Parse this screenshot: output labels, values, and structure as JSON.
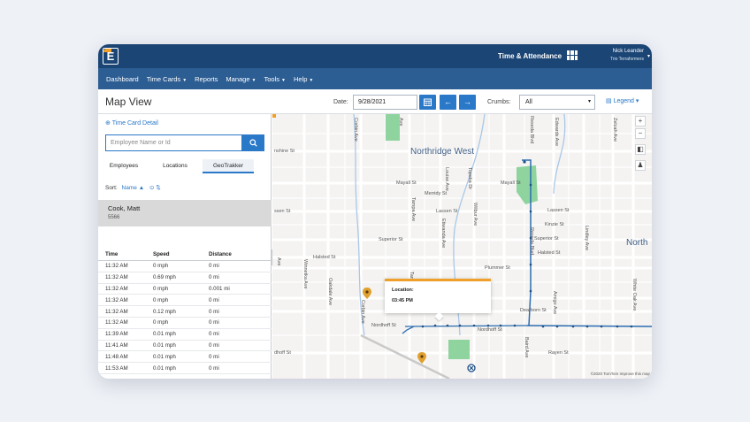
{
  "header": {
    "logo": "E",
    "app_title": "Time & Attendance",
    "user_name": "Nick Leander",
    "user_org": "Trio Terraformers"
  },
  "nav": {
    "items": [
      {
        "label": "Dashboard",
        "has_menu": false
      },
      {
        "label": "Time Cards",
        "has_menu": true
      },
      {
        "label": "Reports",
        "has_menu": false
      },
      {
        "label": "Manage",
        "has_menu": true
      },
      {
        "label": "Tools",
        "has_menu": true
      },
      {
        "label": "Help",
        "has_menu": true
      }
    ]
  },
  "toolbar": {
    "page_title": "Map View",
    "date_label": "Date:",
    "date_value": "9/28/2021",
    "crumbs_label": "Crumbs:",
    "crumbs_value": "All",
    "legend_label": "Legend"
  },
  "left_panel": {
    "time_card_link": "Time Card Detail",
    "search_placeholder": "Employee Name or Id",
    "tabs": [
      "Employees",
      "Locations",
      "GeoTrakker"
    ],
    "active_tab": "GeoTrakker",
    "sort_label": "Sort:",
    "sort_field": "Name",
    "employee": {
      "name": "Cook, Matt",
      "id": "5566"
    },
    "table": {
      "headers": [
        "Time",
        "Speed",
        "Distance"
      ],
      "rows": [
        [
          "11:32 AM",
          "0 mph",
          "0 mi"
        ],
        [
          "11:32 AM",
          "0.69 mph",
          "0 mi"
        ],
        [
          "11:32 AM",
          "0 mph",
          "0.001 mi"
        ],
        [
          "11:32 AM",
          "0 mph",
          "0 mi"
        ],
        [
          "11:32 AM",
          "0.12 mph",
          "0 mi"
        ],
        [
          "11:32 AM",
          "0 mph",
          "0 mi"
        ],
        [
          "11:39 AM",
          "0.01 mph",
          "0 mi"
        ],
        [
          "11:41 AM",
          "0.01 mph",
          "0 mi"
        ],
        [
          "11:48 AM",
          "0.01 mph",
          "0 mi"
        ],
        [
          "11:53 AM",
          "0.01 mph",
          "0 mi"
        ]
      ]
    }
  },
  "map": {
    "area_labels": [
      "Northridge West",
      "North"
    ],
    "street_labels": [
      "nshine St",
      "Mayall St",
      "Merridy St",
      "ssen St",
      "Lassen St",
      "Superior St",
      "Halsted St",
      "Plummer St",
      "Nordhoff St",
      "Nordhoff St",
      "dhoff St",
      "Rayen St",
      "Mayall St",
      "Lassen St",
      "Kinzie St",
      "Superior St",
      "Halsted St",
      "Dearborn St"
    ],
    "vertical_labels": [
      "Corbin Ave",
      "Tampa Ave",
      "Wilbur Ave",
      "Topeka Dr",
      "Oakdale Ave",
      "Winnetka Ave",
      "Tampa Ave",
      "Corbin Ave",
      "Reseda Blvd",
      "Zelzah Ave",
      "Lindley Ave",
      "White Oak Ave",
      "Baird Ave",
      "Edwards Ave",
      "Amigo Ave",
      "Etiwanda Ave",
      "Louise Ave",
      "Reseda Blvd",
      "Ave",
      "Ave"
    ],
    "popup": {
      "location_label": "Location:",
      "time": "03:45 PM"
    },
    "copyright": "©2020 TomTom Improve this map",
    "zoom_in": "+",
    "zoom_out": "−",
    "colors": {
      "route": "#2b6cb0",
      "water": "#a9c7e8",
      "park": "#8fd49e",
      "marker": "#e0a030"
    }
  }
}
